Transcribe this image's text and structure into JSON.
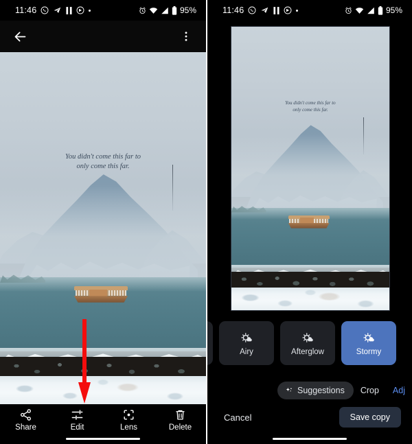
{
  "status_bar": {
    "time": "11:46",
    "battery": "95%",
    "icons_left": [
      "whatsapp-icon",
      "telegram-icon",
      "pause-icon",
      "circle-arrow-icon",
      "dot-icon"
    ],
    "icons_right": [
      "alarm-icon",
      "wifi-icon",
      "signal-icon",
      "battery-icon"
    ]
  },
  "photo": {
    "quote_line1": "You didn't come this far to",
    "quote_line2": "only come this far."
  },
  "left_panel": {
    "appbar": {
      "back_label": "Back",
      "more_label": "More options"
    },
    "bottom_bar": [
      {
        "label": "Share",
        "icon": "share-icon"
      },
      {
        "label": "Edit",
        "icon": "edit-sliders-icon"
      },
      {
        "label": "Lens",
        "icon": "lens-icon"
      },
      {
        "label": "Delete",
        "icon": "trash-icon"
      }
    ],
    "annotation": {
      "arrow": "red-down-arrow",
      "arrow_color": "#f40d0d",
      "points_to": "Edit"
    }
  },
  "right_panel": {
    "filters": [
      {
        "label": "",
        "icon": "brightness-icon",
        "selected": false,
        "partial": true
      },
      {
        "label": "Airy",
        "icon": "brightness-icon",
        "selected": false,
        "partial": false
      },
      {
        "label": "Afterglow",
        "icon": "brightness-icon",
        "selected": false,
        "partial": false
      },
      {
        "label": "Stormy",
        "icon": "brightness-icon",
        "selected": true,
        "partial": false
      }
    ],
    "selected_filter": "Stormy",
    "selected_filter_color": "#4d74bd",
    "tabs": [
      {
        "label": "Suggestions",
        "style": "pill",
        "icon": "sparkle-icon"
      },
      {
        "label": "Crop",
        "style": "plain"
      },
      {
        "label": "Adj",
        "style": "accent"
      }
    ],
    "accent_color": "#5b8def",
    "actions": {
      "cancel_label": "Cancel",
      "save_label": "Save copy"
    }
  }
}
